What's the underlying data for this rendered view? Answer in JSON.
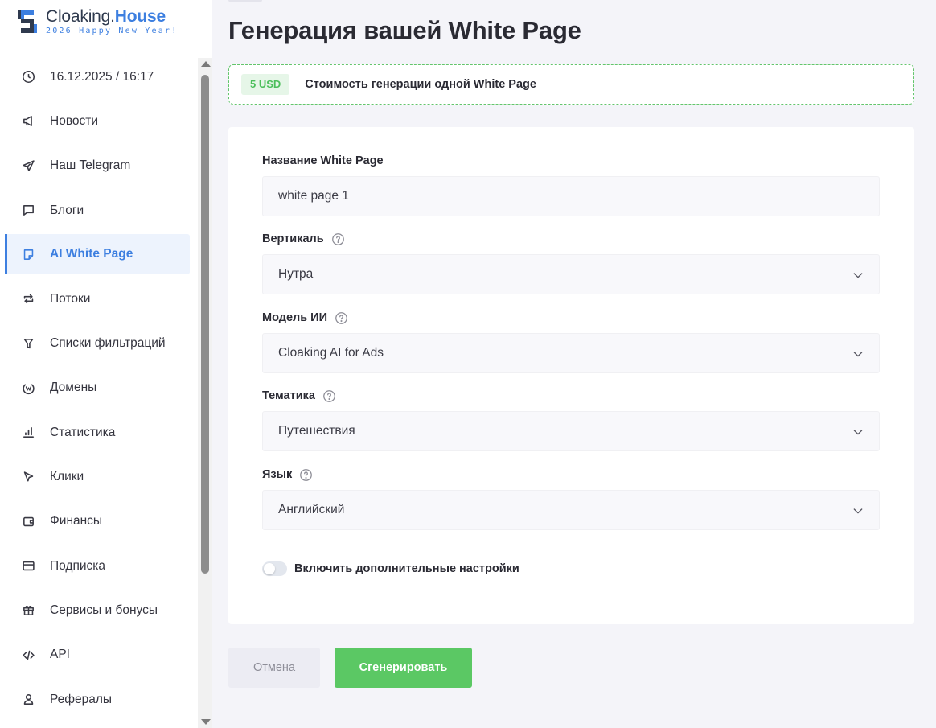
{
  "logo": {
    "title_part1": "Cloaking.",
    "title_part2": "House",
    "subtitle": "2026 Happy New Year!"
  },
  "sidebar": {
    "items": [
      {
        "label": "16.12.2025 / 16:17",
        "icon": "clock-icon"
      },
      {
        "label": "Новости",
        "icon": "megaphone-icon"
      },
      {
        "label": "Наш Telegram",
        "icon": "telegram-icon"
      },
      {
        "label": "Блоги",
        "icon": "chat-icon"
      },
      {
        "label": "AI White Page",
        "icon": "page-icon",
        "active": true
      },
      {
        "label": "Потоки",
        "icon": "repeat-icon"
      },
      {
        "label": "Списки фильтраций",
        "icon": "filter-icon"
      },
      {
        "label": "Домены",
        "icon": "globe-icon"
      },
      {
        "label": "Статистика",
        "icon": "bar-chart-icon"
      },
      {
        "label": "Клики",
        "icon": "cursor-icon"
      },
      {
        "label": "Финансы",
        "icon": "wallet-icon"
      },
      {
        "label": "Подписка",
        "icon": "card-icon"
      },
      {
        "label": "Сервисы и бонусы",
        "icon": "gift-icon"
      },
      {
        "label": "API",
        "icon": "code-icon"
      },
      {
        "label": "Рефералы",
        "icon": "user-icon"
      }
    ]
  },
  "main": {
    "title": "Генерация вашей White Page",
    "price": {
      "badge": "5 USD",
      "text": "Стоимость генерации одной White Page"
    },
    "form": {
      "name": {
        "label": "Название White Page",
        "value": "white page 1"
      },
      "vertical": {
        "label": "Вертикаль",
        "value": "Нутра"
      },
      "model": {
        "label": "Модель ИИ",
        "value": "Cloaking AI for Ads"
      },
      "topic": {
        "label": "Тематика",
        "value": "Путешествия"
      },
      "language": {
        "label": "Язык",
        "value": "Английский"
      },
      "advanced_toggle": {
        "label": "Включить дополнительные настройки",
        "enabled": false
      }
    },
    "buttons": {
      "cancel": "Отмена",
      "generate": "Сгенерировать"
    }
  },
  "colors": {
    "accent": "#3d7fe0",
    "success": "#5bc864",
    "background": "#f4f4f9"
  }
}
